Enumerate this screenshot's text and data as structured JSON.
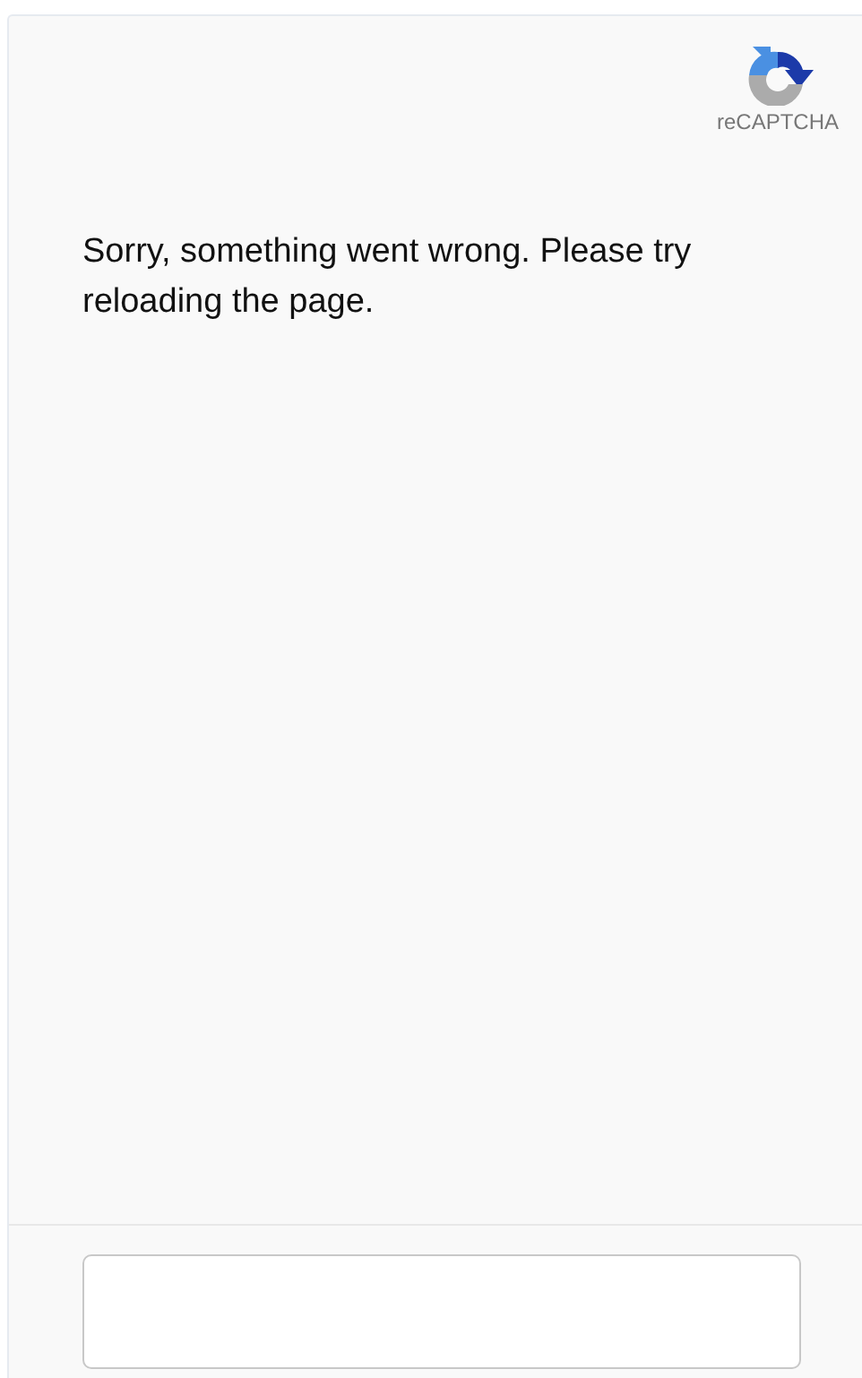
{
  "logo": {
    "caption": "reCAPTCHA"
  },
  "message": "Sorry, something went wrong. Please try reloading the page."
}
